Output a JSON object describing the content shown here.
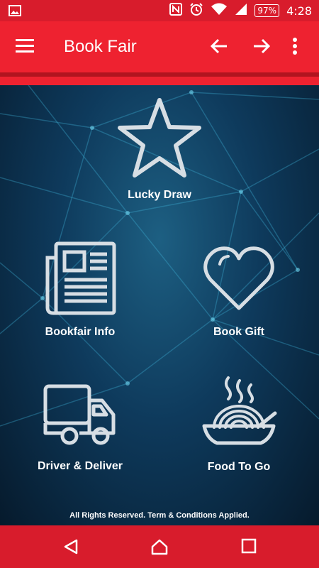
{
  "status_bar": {
    "time": "4:28",
    "battery": "97%",
    "icons": [
      "image-icon",
      "nfc-icon",
      "alarm-icon",
      "wifi-icon",
      "signal-icon",
      "battery-icon"
    ]
  },
  "app_bar": {
    "title": "Book Fair",
    "icons": [
      "menu-icon",
      "arrow-back-icon",
      "arrow-forward-icon",
      "more-vert-icon"
    ],
    "color": "#ee2230"
  },
  "tiles": [
    {
      "label": "Lucky Draw",
      "icon": "star-icon"
    },
    {
      "label": "Bookfair Info",
      "icon": "newspaper-icon"
    },
    {
      "label": "Book Gift",
      "icon": "heart-icon"
    },
    {
      "label": "Driver & Deliver",
      "icon": "truck-icon"
    },
    {
      "label": "Food To Go",
      "icon": "noodle-bowl-icon"
    }
  ],
  "footer": {
    "text": "All Rights Reserved. Term & Conditions Applied."
  },
  "nav_bar": {
    "icons": [
      "back-triangle-icon",
      "home-icon",
      "recents-square-icon"
    ],
    "color": "#d81c2c"
  }
}
